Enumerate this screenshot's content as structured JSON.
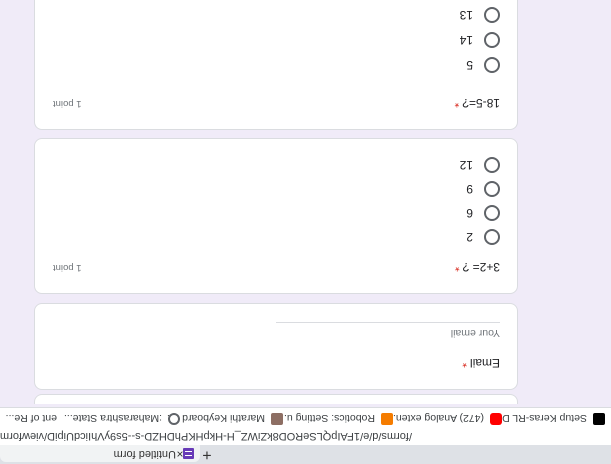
{
  "browser": {
    "tab_title": "Untitled form",
    "tab_close": "×",
    "new_tab": "+",
    "url": "/forms/d/e/1FAIpQLSeROD8kZiWZ_H-HkpHKPhDHZD-s--5s9yVhIicdUipiD/viewform",
    "bookmarks": [
      {
        "label": "Setup Keras-RL D",
        "icon": "keras-icon",
        "color": "#000000"
      },
      {
        "label": "(472) Analog exten...",
        "icon": "youtube-icon",
        "color": "#ff0000"
      },
      {
        "label": "Robotics: Setting u...",
        "icon": "blogger-icon",
        "color": "#f57c00"
      },
      {
        "label": "Marathi Keyboard -...",
        "icon": "keyboard-icon",
        "color": "#8d6e63"
      },
      {
        "label": ":Maharashtra State...",
        "icon": "globe-icon",
        "color": "#5f6368"
      },
      {
        "label": "ent of Re...",
        "icon": "",
        "color": ""
      }
    ]
  },
  "form": {
    "email_card": {
      "label": "Email",
      "placeholder": "Your email"
    },
    "questions": [
      {
        "title": "3+2= ?",
        "points": "1 point",
        "options": [
          "2",
          "6",
          "9",
          "12"
        ]
      },
      {
        "title": "18-5=?",
        "points": "1 point",
        "options": [
          "5",
          "14",
          "13"
        ]
      }
    ],
    "required_mark": "*"
  }
}
